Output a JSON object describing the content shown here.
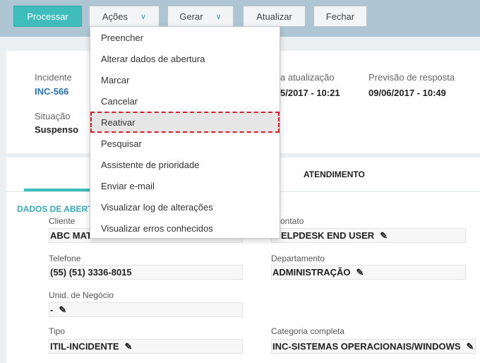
{
  "toolbar": {
    "processar": "Processar",
    "acoes": "Ações",
    "gerar": "Gerar",
    "atualizar": "Atualizar",
    "fechar": "Fechar"
  },
  "header": {
    "incidente_label": "Incidente",
    "incidente_value": "INC-566",
    "situacao_label": "Situação",
    "situacao_value": "Suspenso",
    "atualizacao_label": "a atualização",
    "atualizacao_value": "5/2017 - 10:21",
    "previsao_label": "Previsão de resposta",
    "previsao_value": "09/06/2017 - 10:49"
  },
  "tabs": {
    "atendimento": "ATENDIMENTO"
  },
  "section": {
    "title": "DADOS DE ABERT"
  },
  "fields": {
    "cliente_label": "Cliente",
    "cliente_value": "ABC MAT",
    "contato_label": "ontato",
    "contato_value": "ELPDESK END USER",
    "telefone_label": "Telefone",
    "telefone_value": "(55) (51) 3336-8015",
    "departamento_label": "Departamento",
    "departamento_value": "ADMINISTRAÇÃO",
    "unidade_label": "Unid. de Negócio",
    "unidade_value": "-",
    "tipo_label": "Tipo",
    "tipo_value": "ITIL-INCIDENTE",
    "categoria_label": "Categoria completa",
    "categoria_value": "INC-SISTEMAS OPERACIONAIS/WINDOWS"
  },
  "menu": {
    "items": [
      "Preencher",
      "Alterar dados de abertura",
      "Marcar",
      "Cancelar",
      "Reativar",
      "Pesquisar",
      "Assistente de prioridade",
      "Enviar e-mail",
      "Visualizar log de alterações",
      "Visualizar erros conhecidos"
    ],
    "selected": "Reativar"
  },
  "colors": {
    "accent": "#3fbcbc",
    "link": "#2a6fb0",
    "highlight": "#d0212c",
    "topbar": "#aec6d4"
  }
}
